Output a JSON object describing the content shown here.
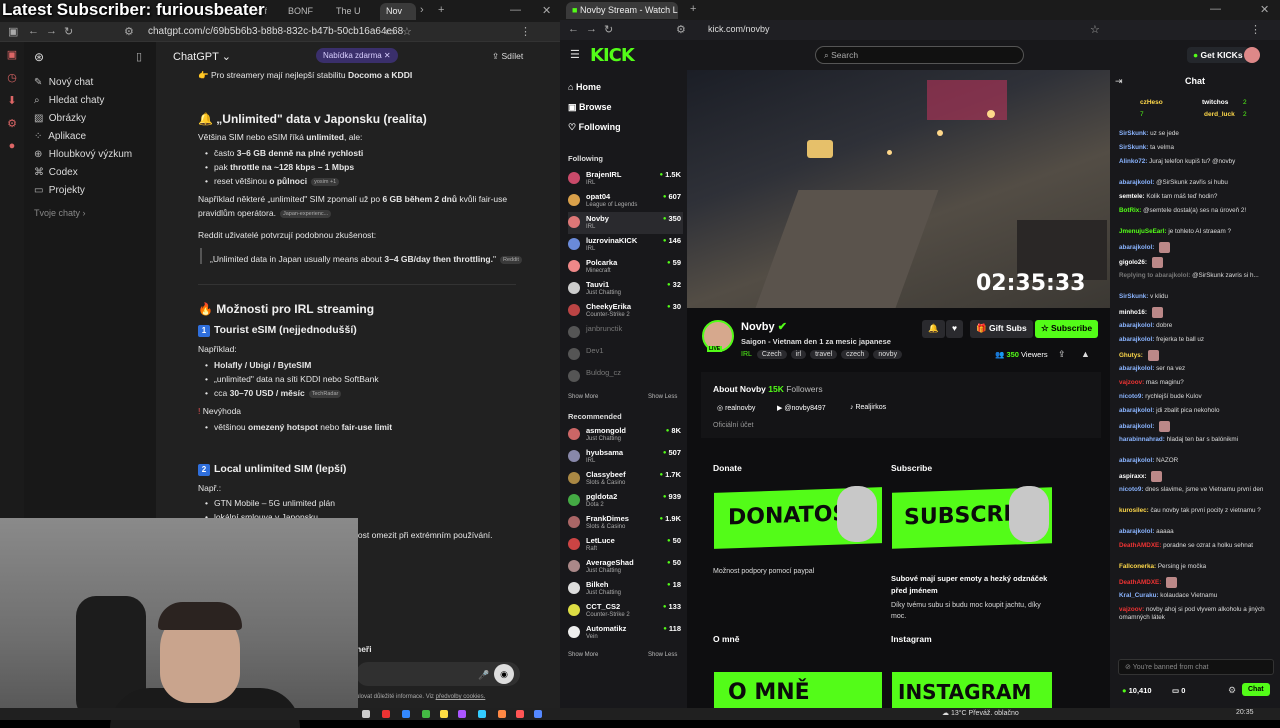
{
  "overlay_title": "Latest Subscriber: furiousbeater",
  "left": {
    "tabs": [
      "nd f",
      "BONF",
      "The U",
      "Nov"
    ],
    "url": "chatgpt.com/c/69b5b6b3-b8b8-832c-b47b-50cb16a64e68",
    "sidebar": [
      "Nový chat",
      "Hledat chaty",
      "Obrázky",
      "Aplikace",
      "Hloubkový výzkum",
      "Codex",
      "Projekty",
      "Tvoje chaty"
    ],
    "model": "ChatGPT",
    "badge": "Nabídka zdarma",
    "share": "Sdílet",
    "lines": {
      "l1a": "Pro streamery mají nejlepší stabilitu ",
      "l1b": "Docomo a KDDI",
      "h_unlimited": "„Unlimited\" data v Japonsku (realita)",
      "p1a": "Většina SIM nebo eSIM říká ",
      "p1b": "unlimited",
      ", ale:": ", ale:",
      "b1a": "často ",
      "b1b": "3–6 GB denně na plné rychlosti",
      "b2a": "pak ",
      "b2b": "throttle na ~128 kbps – 1 Mbps",
      "b3a": "reset většinou ",
      "b3b": "o půlnoci",
      "b3tag": "yosim +1",
      "p2a": "Například některé „unlimited\" SIM zpomalí už po ",
      "p2b": "6 GB během 2 dnů",
      " p2c": "",
      "p2c": " kvůli fair-use",
      "p2d": "pravidlům operátora.",
      "p2tag": "Japan-experienc...",
      "p3": "Reddit uživatelé potvrzují podobnou zkušenost:",
      "q1a": "„Unlimited data in Japan usually means about ",
      "q1b": "3–4 GB/day then throttling.",
      "q1c": "\"",
      "q1tag": "Reddit",
      "h_irl": "Možnosti pro IRL streaming",
      "h_t1": "Tourist eSIM (nejjednodušší)",
      "n1": "1",
      "ex": "Například:",
      "e1": "Holafly / Ubigi / ByteSIM",
      "e2a": "„unlimited\" data na síti ",
      "e2b": "KDDI nebo SoftBank",
      "e3a": "cca ",
      "e3b": "30–70 USD / měsíc",
      "e3tag": "TechRadar",
      "dis": "Nevýhoda",
      "d1a": "většinou ",
      "d1b": "omezený hotspot",
      " d1c": "",
      "d1c": " nebo ",
      "d1d": "fair-use limit",
      "h_t2": "Local unlimited SIM (lepší)",
      "n2": "2",
      "ex2": "Např.:",
      "f1": "GTN Mobile – 5G unlimited plán",
      "f2": "lokální smlouva v Japonsku",
      "f3": "lost omezit při extrémním používání.",
      "f4": "neři",
      "foot": "ulovat důležité informace. Viz ",
      "footlink": "předvolby cookies."
    }
  },
  "right": {
    "tab": "Novby Stream - Watch Live o",
    "url": "kick.com/novby",
    "logo": "KICK",
    "search": "Search",
    "getkicks": "Get KICKs",
    "nav": [
      "Home",
      "Browse",
      "Following"
    ],
    "following_title": "Following",
    "following": [
      {
        "name": "BrajenIRL",
        "cat": "IRL",
        "v": "1.5K",
        "c": "#c94a6a"
      },
      {
        "name": "opat04",
        "cat": "League of Legends",
        "v": "607",
        "c": "#d9a04a"
      },
      {
        "name": "Novby",
        "cat": "IRL",
        "v": "350",
        "c": "#d77"
      },
      {
        "name": "luzrovinaKICK",
        "cat": "IRL",
        "v": "146",
        "c": "#6a8ad9"
      },
      {
        "name": "Polcarka",
        "cat": "Minecraft",
        "v": "59",
        "c": "#e88"
      },
      {
        "name": "Tauvi1",
        "cat": "Just Chatting",
        "v": "32",
        "c": "#ccc"
      },
      {
        "name": "CheekyErika",
        "cat": "Counter-Strike 2",
        "v": "30",
        "c": "#b44"
      },
      {
        "name": "janbrunctik",
        "cat": "",
        "v": "",
        "c": "#555"
      },
      {
        "name": "Dev1",
        "cat": "",
        "v": "",
        "c": "#555"
      },
      {
        "name": "Buldog_cz",
        "cat": "",
        "v": "",
        "c": "#555"
      }
    ],
    "show_more": "Show More",
    "show_less": "Show Less",
    "recommended_title": "Recommended",
    "recommended": [
      {
        "name": "asmongold",
        "cat": "Just Chatting",
        "v": "8K",
        "c": "#c66"
      },
      {
        "name": "hyubsama",
        "cat": "IRL",
        "v": "507",
        "c": "#88a"
      },
      {
        "name": "Classybeef",
        "cat": "Slots & Casino",
        "v": "1.7K",
        "c": "#a84"
      },
      {
        "name": "pgldota2",
        "cat": "Dota 2",
        "v": "939",
        "c": "#4a4"
      },
      {
        "name": "FrankDimes",
        "cat": "Slots & Casino",
        "v": "1.9K",
        "c": "#a66"
      },
      {
        "name": "LetLuce",
        "cat": "Raft",
        "v": "50",
        "c": "#c44"
      },
      {
        "name": "AverageShad",
        "cat": "Just Chatting",
        "v": "50",
        "c": "#a88"
      },
      {
        "name": "Bilkeh",
        "cat": "Just Chatting",
        "v": "18",
        "c": "#ddd"
      },
      {
        "name": "CCT_CS2",
        "cat": "Counter-Strike 2",
        "v": "133",
        "c": "#dd4"
      },
      {
        "name": "Automatikz",
        "cat": "Vein",
        "v": "118",
        "c": "#eee"
      }
    ],
    "timer": "02:35:33",
    "streamer": "Novby",
    "stream_title": "Saigon - Vietnam den 1 za mesic japanese",
    "tags": [
      "IRL",
      "Czech",
      "irl",
      "travel",
      "czech",
      "novby"
    ],
    "live": "LIVE",
    "gift": "Gift Subs",
    "subscribe": "Subscribe",
    "viewers": "350",
    "viewers_label": "Viewers",
    "about_title": "About Novby",
    "followers": "15K",
    "followers_label": "Followers",
    "socials": [
      "realnovby",
      "@novby8497",
      "Realjirkos"
    ],
    "official": "Oficiální účet",
    "donate_h": "Donate",
    "subscribe_h": "Subscribe",
    "donate_img": "DONATOSS",
    "sub_img": "SUBSCRIBE",
    "donate_txt": "Možnost podpory pomocí paypal",
    "sub_txt1": "Subové mají super emoty a hezký odznáček",
    "sub_txt2": "před jménem",
    "sub_txt3": "Díky tvému subu si budu moc koupit jachtu, díky",
    "sub_txt4": "moc.",
    "omne_h": "O mně",
    "insta_h": "Instagram",
    "omne_img": "O MNĚ",
    "insta_img": "INSTAGRAM",
    "chat_title": "Chat",
    "top": {
      "u1": "czHeso",
      "u2": "twitchos",
      "u3": "derd_luck",
      "n1": "7",
      "n2": "2",
      "n3": "2"
    },
    "messages": [
      {
        "u": "SirSkunk:",
        "t": "uz se jede",
        "c": "#8ab4ff"
      },
      {
        "u": "SirSkunk:",
        "t": "ta velma",
        "c": "#8ab4ff"
      },
      {
        "u": "Alinko72:",
        "t": "Juraj telefon kupiš tu? @novby",
        "c": "#8ab4ff"
      },
      {
        "u": "abarajkolol:",
        "t": "@SirSkunk zavřis si hubu",
        "c": "#8ab4ff"
      },
      {
        "u": "semtele:",
        "t": "Kolik tam máš teď hodin?",
        "c": "#fff"
      },
      {
        "u": "BotRix:",
        "t": "@semtele dostal(a) ses na úroveň 2!",
        "c": "#53fc18"
      },
      {
        "u": "JmenujuSeEarl:",
        "t": "je tohleto AI straeam ?",
        "c": "#53fc18"
      },
      {
        "u": "abarajkolol:",
        "t": "",
        "c": "#8ab4ff"
      },
      {
        "u": "gigolo26:",
        "t": "",
        "c": "#fff"
      },
      {
        "u": "Replying to abarajkolol:",
        "t": "@SirSkunk zavris si h...",
        "c": "#777"
      },
      {
        "u": "SirSkunk:",
        "t": "v klidu",
        "c": "#8ab4ff"
      },
      {
        "u": "minho16:",
        "t": "",
        "c": "#fff"
      },
      {
        "u": "abarajkolol:",
        "t": "dobre",
        "c": "#8ab4ff"
      },
      {
        "u": "abarajkolol:",
        "t": "frejerka te ball uz",
        "c": "#8ab4ff"
      },
      {
        "u": "Ghutys:",
        "t": "",
        "c": "#ffd94a"
      },
      {
        "u": "abarajkolol:",
        "t": "ser na vez",
        "c": "#8ab4ff"
      },
      {
        "u": "vajzoov:",
        "t": "mas maginu?",
        "c": "#e33"
      },
      {
        "u": "nicoto9:",
        "t": "rychlejší bude Kulov",
        "c": "#8ab4ff"
      },
      {
        "u": "abarajkolol:",
        "t": "jdi zbalit pica nekoholo",
        "c": "#8ab4ff"
      },
      {
        "u": "abarajkolol:",
        "t": "",
        "c": "#8ab4ff"
      },
      {
        "u": "harabinnahrad:",
        "t": "hladaj ten bar s balónikmi",
        "c": "#8ab4ff"
      },
      {
        "u": "abarajkolol:",
        "t": "NAZOR",
        "c": "#8ab4ff"
      },
      {
        "u": "aspiraxx:",
        "t": "",
        "c": "#fff"
      },
      {
        "u": "nicoto9:",
        "t": "dnes slavime, jsme ve Vietnamu první den",
        "c": "#8ab4ff"
      },
      {
        "u": "kurosilec:",
        "t": "čau novby tak první pocity z vietnamu ?",
        "c": "#ffd94a"
      },
      {
        "u": "abarajkolol:",
        "t": "aaaaa",
        "c": "#8ab4ff"
      },
      {
        "u": "DeathAMDXE:",
        "t": "poradne se ozrat a holku sehnat",
        "c": "#e33"
      },
      {
        "u": "Fallconerka:",
        "t": "Persing je močka",
        "c": "#ffd94a"
      },
      {
        "u": "DeathAMDXE:",
        "t": "",
        "c": "#e33"
      },
      {
        "u": "Kral_Curaku:",
        "t": "kolaudace Vietnamu",
        "c": "#8ab4ff"
      },
      {
        "u": "vajzoov:",
        "t": "novby ahoj si pod vlyvem alkoholu a jiných omamných látek",
        "c": "#e33"
      }
    ],
    "banned": "You're banned from chat",
    "kicks": "10,410",
    "zero": "0",
    "chat_btn": "Chat"
  },
  "taskbar": {
    "weather": "13°C",
    "weather_txt": "Převáž. oblačno",
    "time": "20:35"
  }
}
